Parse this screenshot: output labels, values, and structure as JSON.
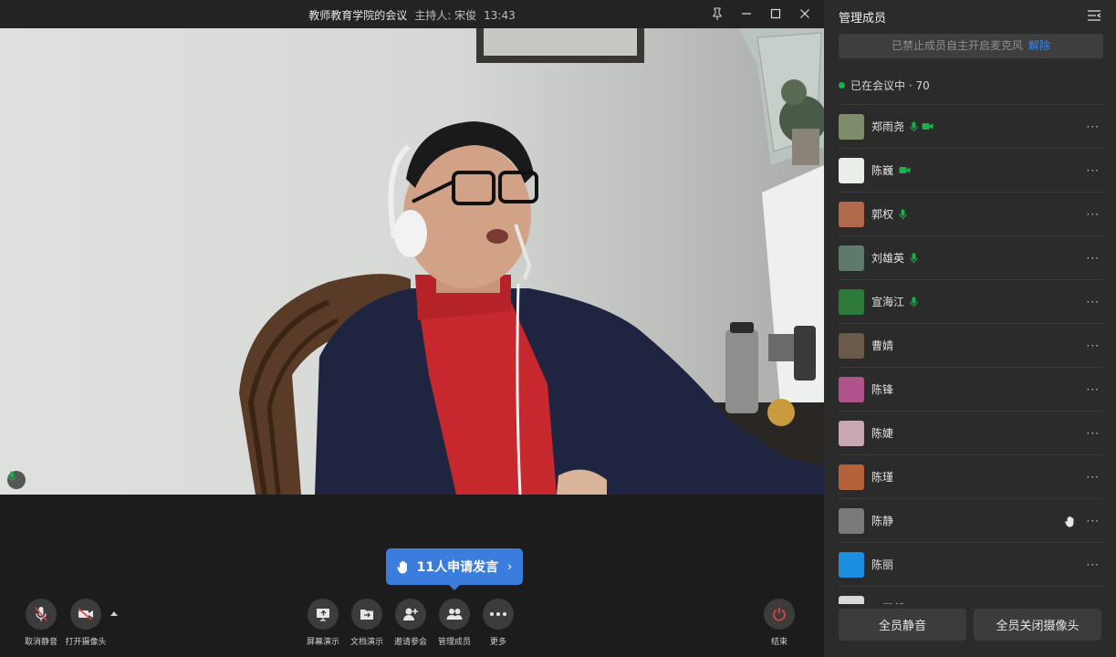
{
  "window": {
    "meeting_name": "教师教育学院的会议",
    "host_label": "主持人: 宋俊",
    "time": "13:43"
  },
  "video": {
    "speaker_mic_icon": "mic-icon"
  },
  "raise_banner": {
    "text": "11人申请发言",
    "icon": "hand-icon"
  },
  "toolbar": {
    "unmute": "取消静音",
    "camera": "打开摄像头",
    "screen_share": "屏幕演示",
    "doc_share": "文档演示",
    "invite": "邀请参会",
    "manage": "管理成员",
    "more": "更多",
    "end": "结束"
  },
  "panel": {
    "title": "管理成员",
    "mute_notice": "已禁止成员自主开启麦克风",
    "mute_notice_action": "解除",
    "in_meeting": "已在会议中 · 70",
    "mute_all": "全员静音",
    "camera_all_off": "全员关闭摄像头",
    "members": [
      {
        "name": "郑雨尧",
        "mic": true,
        "cam": true,
        "hand": false,
        "avatar_color": "#7d8c6a"
      },
      {
        "name": "陈巍",
        "mic": false,
        "cam": true,
        "hand": false,
        "avatar_color": "#e9eee9"
      },
      {
        "name": "郭权",
        "mic": true,
        "cam": false,
        "hand": false,
        "avatar_color": "#b06a4b"
      },
      {
        "name": "刘雄英",
        "mic": true,
        "cam": false,
        "hand": false,
        "avatar_color": "#5e7a6a"
      },
      {
        "name": "宣海江",
        "mic": true,
        "cam": false,
        "hand": false,
        "avatar_color": "#2e7a3a"
      },
      {
        "name": "曹婧",
        "mic": false,
        "cam": false,
        "hand": false,
        "avatar_color": "#6a5a4a"
      },
      {
        "name": "陈锋",
        "mic": false,
        "cam": false,
        "hand": false,
        "avatar_color": "#b0528c"
      },
      {
        "name": "陈婕",
        "mic": false,
        "cam": false,
        "hand": false,
        "avatar_color": "#c9a6b4"
      },
      {
        "name": "陈瑾",
        "mic": false,
        "cam": false,
        "hand": false,
        "avatar_color": "#b5623a"
      },
      {
        "name": "陈静",
        "mic": false,
        "cam": false,
        "hand": true,
        "avatar_color": "#7a7a7a"
      },
      {
        "name": "陈丽",
        "mic": false,
        "cam": false,
        "hand": false,
        "avatar_color": "#1d8fe0"
      },
      {
        "name": "丁正邦",
        "mic": false,
        "cam": false,
        "hand": false,
        "avatar_color": "#d8d8d8"
      }
    ]
  }
}
